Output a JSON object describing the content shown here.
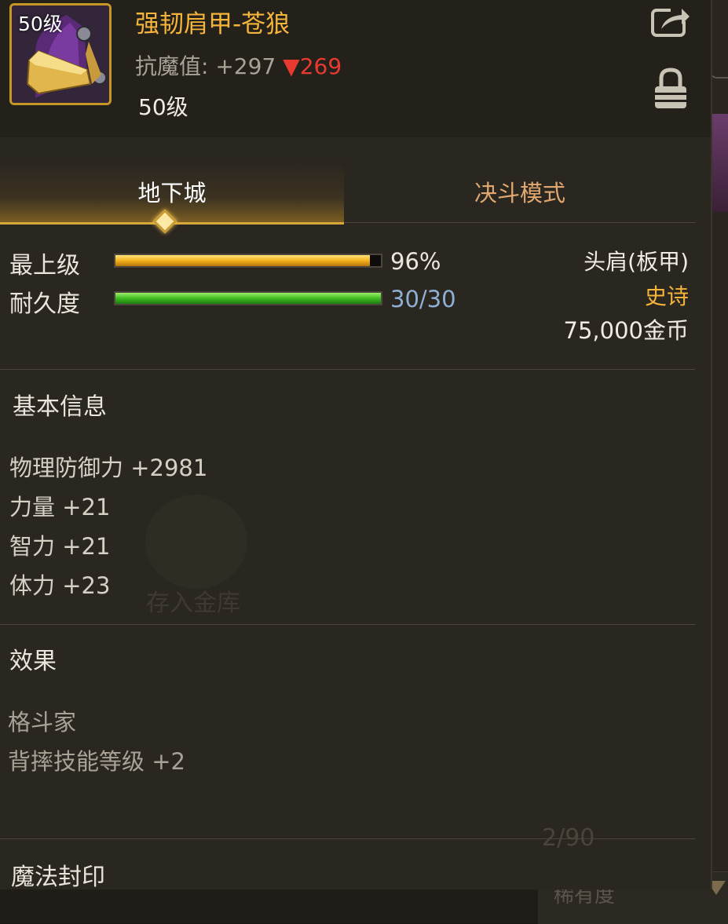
{
  "item": {
    "icon": "shoulder-armor-icon",
    "level_badge": "50级",
    "name": "强韧肩甲-苍狼",
    "stat_label": "抗魔值:",
    "stat_value": "+297",
    "stat_change_symbol": "▼",
    "stat_change_value": "269",
    "level_text": "50级"
  },
  "tabs": [
    {
      "label": "地下城",
      "active": true
    },
    {
      "label": "决斗模式",
      "active": false
    }
  ],
  "bars": {
    "grade": {
      "label": "最上级",
      "value_text": "96%",
      "fraction": 0.96,
      "color": "#f3b11e"
    },
    "durability": {
      "label": "耐久度",
      "value_text": "30/30",
      "fraction": 1.0,
      "color": "#3fbd22"
    }
  },
  "info": {
    "slot_type": "头肩(板甲)",
    "rarity": "史诗",
    "price": "75,000金币"
  },
  "sections": {
    "basic_title": "基本信息",
    "basic_attrs": [
      "物理防御力 +2981",
      "力量 +21",
      "智力 +21",
      "体力 +23"
    ],
    "effect_title": "效果",
    "effects": [
      "格斗家",
      "背摔技能等级 +2"
    ],
    "seal_title": "魔法封印"
  },
  "background": {
    "vault_label": "存入金库",
    "count": "2/90",
    "rarity_dropdown": "稀有度"
  },
  "colors": {
    "accent_gold": "#f5b43a",
    "stat_down": "#e83a30",
    "durability_text": "#8fb0d6",
    "panel_bg": "#2a2620"
  }
}
